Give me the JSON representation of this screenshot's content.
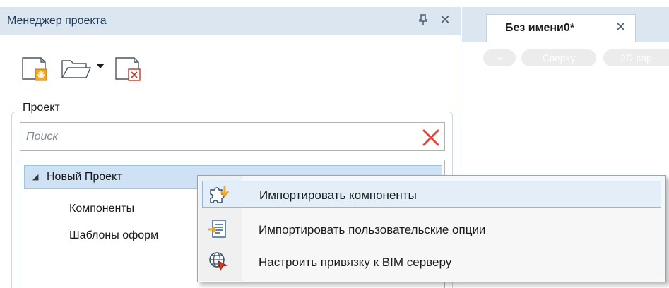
{
  "panel": {
    "title": "Менеджер проекта",
    "pin_glyph": "ᵖ",
    "close_glyph": "✕",
    "toolbar": {
      "new_icon": "new-project-icon",
      "open_icon": "open-folder-icon",
      "open_dropdown_icon": "dropdown-arrow-icon",
      "delete_icon": "delete-project-icon"
    },
    "group_label": "Проект",
    "search": {
      "placeholder": "Поиск",
      "value": ""
    },
    "tree": {
      "root": "Новый Проект",
      "children": [
        "Компоненты",
        "Шаблоны оформ"
      ]
    }
  },
  "document": {
    "tab_label": "Без имени0*",
    "tab_close": "✕",
    "view_pills": [
      "+",
      "Сверху",
      "2D-кар"
    ]
  },
  "context_menu": {
    "items": [
      {
        "label": "Импортировать компоненты",
        "icon": "import-components-icon",
        "highlighted": true
      },
      {
        "label": "Импортировать пользовательские опции",
        "icon": "import-options-icon",
        "highlighted": false
      },
      {
        "label": "Настроить привязку к BIM серверу",
        "icon": "bim-server-icon",
        "highlighted": false
      }
    ]
  },
  "colors": {
    "header_bg": "#dbe6f1",
    "selection_bg": "#cfe2f5",
    "menu_highlight": "#e3eef9",
    "clear_icon_red": "#e0463c",
    "icon_orange": "#f5a623"
  }
}
